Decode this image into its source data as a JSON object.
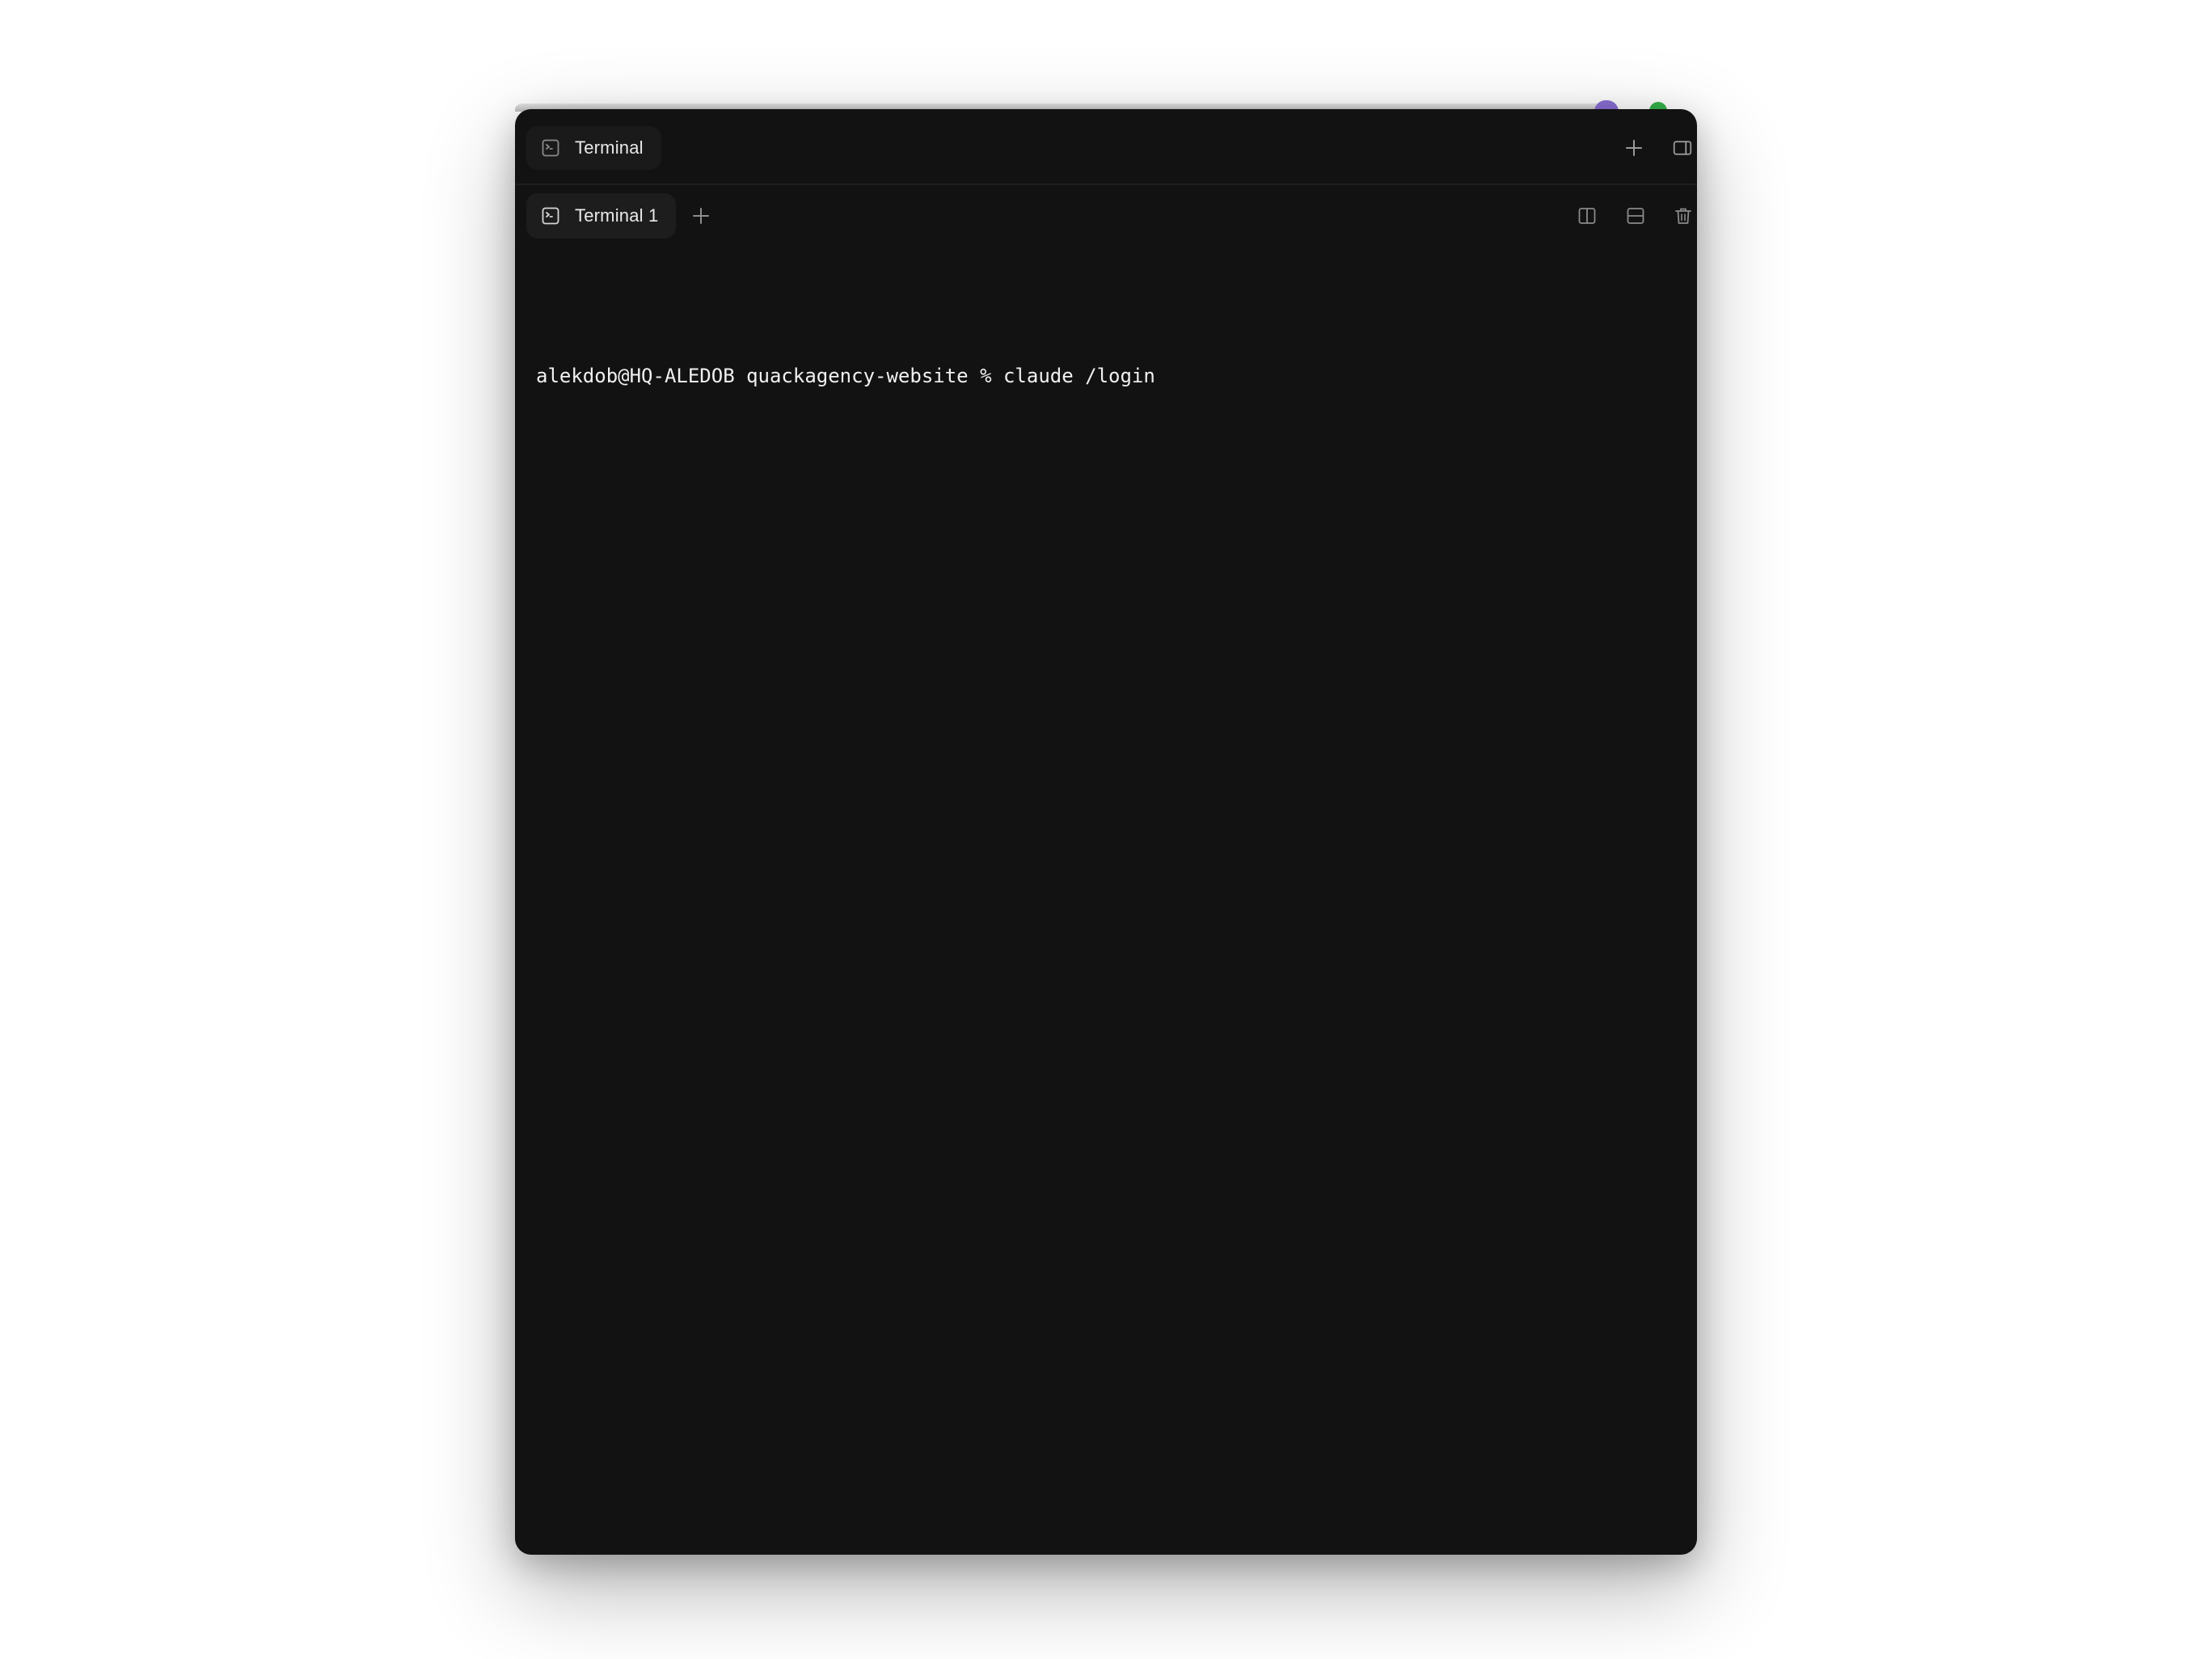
{
  "window": {
    "title_tab_label": "Terminal",
    "accent_bg": "#121212"
  },
  "titlebar": {
    "new_button_icon": "plus-icon",
    "panel_toggle_icon": "sidebar-toggle-icon"
  },
  "tabs": [
    {
      "label": "Terminal 1",
      "active": true,
      "icon": "terminal-icon"
    }
  ],
  "tabbar": {
    "add_tab_icon": "plus-icon",
    "split_vertical_icon": "split-vertical-icon",
    "split_horizontal_icon": "split-horizontal-icon",
    "delete_icon": "trash-icon"
  },
  "terminal": {
    "prompt": "alekdob@HQ-ALEDOB quackagency-website % ",
    "command": "claude /login"
  }
}
